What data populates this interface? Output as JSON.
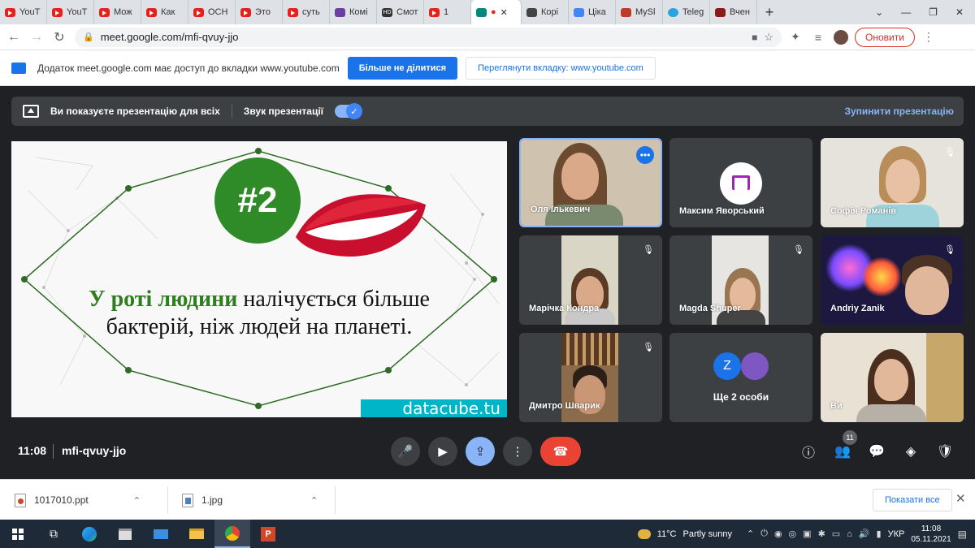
{
  "browser": {
    "tabs": [
      {
        "label": "YouT",
        "icon": "youtube-icon"
      },
      {
        "label": "YouT",
        "icon": "youtube-icon"
      },
      {
        "label": "Мож",
        "icon": "youtube-icon"
      },
      {
        "label": "Как",
        "icon": "youtube-icon"
      },
      {
        "label": "ОСН",
        "icon": "youtube-icon"
      },
      {
        "label": "Это",
        "icon": "youtube-icon"
      },
      {
        "label": "суть",
        "icon": "youtube-icon"
      },
      {
        "label": "Комі",
        "icon": "page-icon"
      },
      {
        "label": "Смот",
        "icon": "hd-icon"
      },
      {
        "label": "1",
        "icon": "youtube-icon"
      },
      {
        "label": "",
        "icon": "meet-icon"
      },
      {
        "label": "Корі",
        "icon": "doc-icon"
      },
      {
        "label": "Ціка",
        "icon": "page-icon"
      },
      {
        "label": "MySl",
        "icon": "page-icon"
      },
      {
        "label": "Teleg",
        "icon": "telegram-icon"
      },
      {
        "label": "Вчен",
        "icon": "page-icon"
      }
    ],
    "url": "meet.google.com/mfi-qvuy-jjo",
    "update_label": "Оновити"
  },
  "sharebar": {
    "message": "Додаток meet.google.com має доступ до вкладки www.youtube.com",
    "stop_sharing": "Більше не ділитися",
    "view_tab": "Переглянути вкладку: www.youtube.com"
  },
  "presentation": {
    "status": "Ви показуєте презентацію для всіх",
    "audio_label": "Звук презентації",
    "stop_label": "Зупинити презентацію"
  },
  "slide": {
    "number": "#2",
    "highlight": "У роті людини",
    "text_rest": " налічується більше бактерій, ніж людей на планеті.",
    "brand": "datacube.tu"
  },
  "participants": [
    {
      "name": "Оля Ількевич",
      "muted": false
    },
    {
      "name": "Максим Яворський",
      "muted": false
    },
    {
      "name": "Софія Романів",
      "muted": true
    },
    {
      "name": "Марічка Кондра",
      "muted": true
    },
    {
      "name": "Magda Shuper",
      "muted": true
    },
    {
      "name": "Andriy Zanik",
      "muted": true
    },
    {
      "name": "Дмитро Шварик",
      "muted": true
    },
    {
      "name": "Ще 2 особи",
      "muted": false
    },
    {
      "name": "Ви",
      "muted": false
    }
  ],
  "others_initial": "Z",
  "meeting": {
    "time": "11:08",
    "code": "mfi-qvuy-jjo",
    "participant_count": "11"
  },
  "downloads": {
    "items": [
      "1017010.ppt",
      "1.jpg"
    ],
    "show_all": "Показати все"
  },
  "taskbar": {
    "weather": "11°C",
    "weather_text": "Partly sunny",
    "lang": "УКР",
    "time": "11:08",
    "date": "05.11.2021"
  },
  "colors": {
    "meet_bg": "#202124",
    "accent_blue": "#1a73e8",
    "hangup_red": "#ea4335",
    "slide_green": "#2e8b27"
  }
}
